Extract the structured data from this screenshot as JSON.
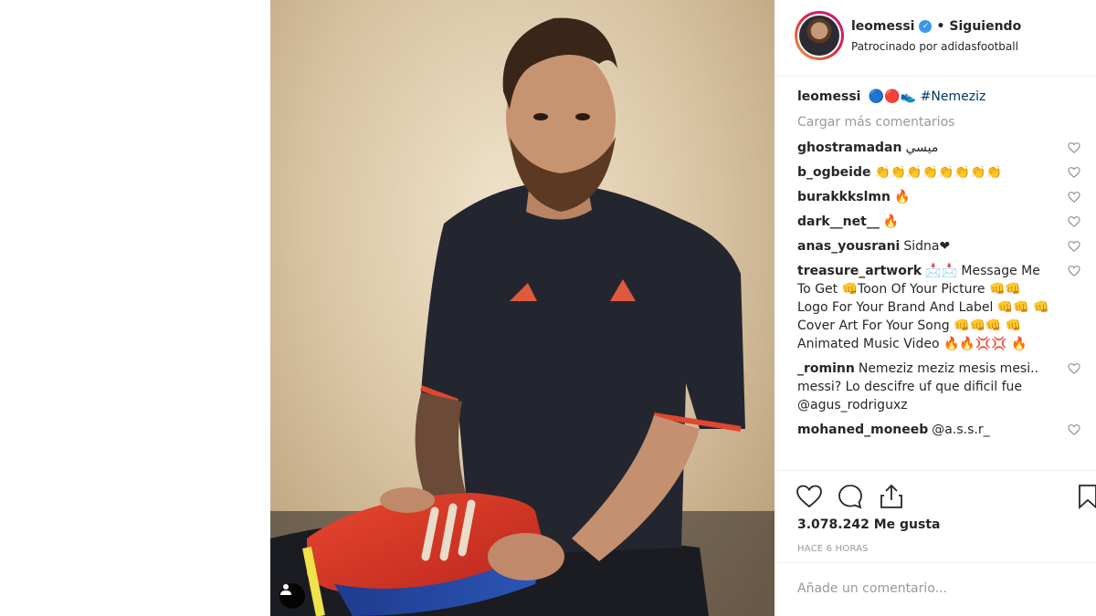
{
  "post": {
    "username": "leomessi",
    "separator": "•",
    "follow_status": "Siguiendo",
    "sponsored": "Patrocinado por adidasfootball",
    "verified_mark": "✓"
  },
  "caption": {
    "username": "leomessi",
    "emojis": "🔵🔴👟",
    "hashtag": "#Nemeziz"
  },
  "load_more": "Cargar más comentarios",
  "comments": [
    {
      "user": "ghostramadan",
      "text": "ميسي"
    },
    {
      "user": "b_ogbeide",
      "text": "👏👏👏👏👏👏👏👏"
    },
    {
      "user": "burakkkslmn",
      "text": "🔥"
    },
    {
      "user": "dark__net__",
      "text": "🔥"
    },
    {
      "user": "anas_yousrani",
      "text": "Sidna❤"
    },
    {
      "user": "treasure_artwork",
      "text": "📩📩 Message Me To Get 👊Toon Of Your Picture 👊👊 Logo For Your Brand And Label 👊👊 👊 Cover Art For Your Song 👊👊👊 👊 Animated Music Video 🔥🔥💢💢 🔥"
    },
    {
      "user": "_rominn",
      "text": "Nemeziz meziz mesis mesi.. messi? Lo descifre uf que dificil fue @agus_rodriguxz"
    },
    {
      "user": "mohaned_moneeb",
      "text": "@a.s.s.r_"
    }
  ],
  "likes": "3.078.242 Me gusta",
  "time_ago": "HACE 6 HORAS",
  "comment_placeholder": "Añade un comentario...",
  "icons": {
    "heart": "heart-icon",
    "comment": "comment-icon",
    "share": "share-icon",
    "bookmark": "bookmark-icon",
    "tag": "user-tag-icon"
  },
  "colors": {
    "verified": "#3897f0",
    "link": "#003569",
    "muted": "#999999"
  }
}
